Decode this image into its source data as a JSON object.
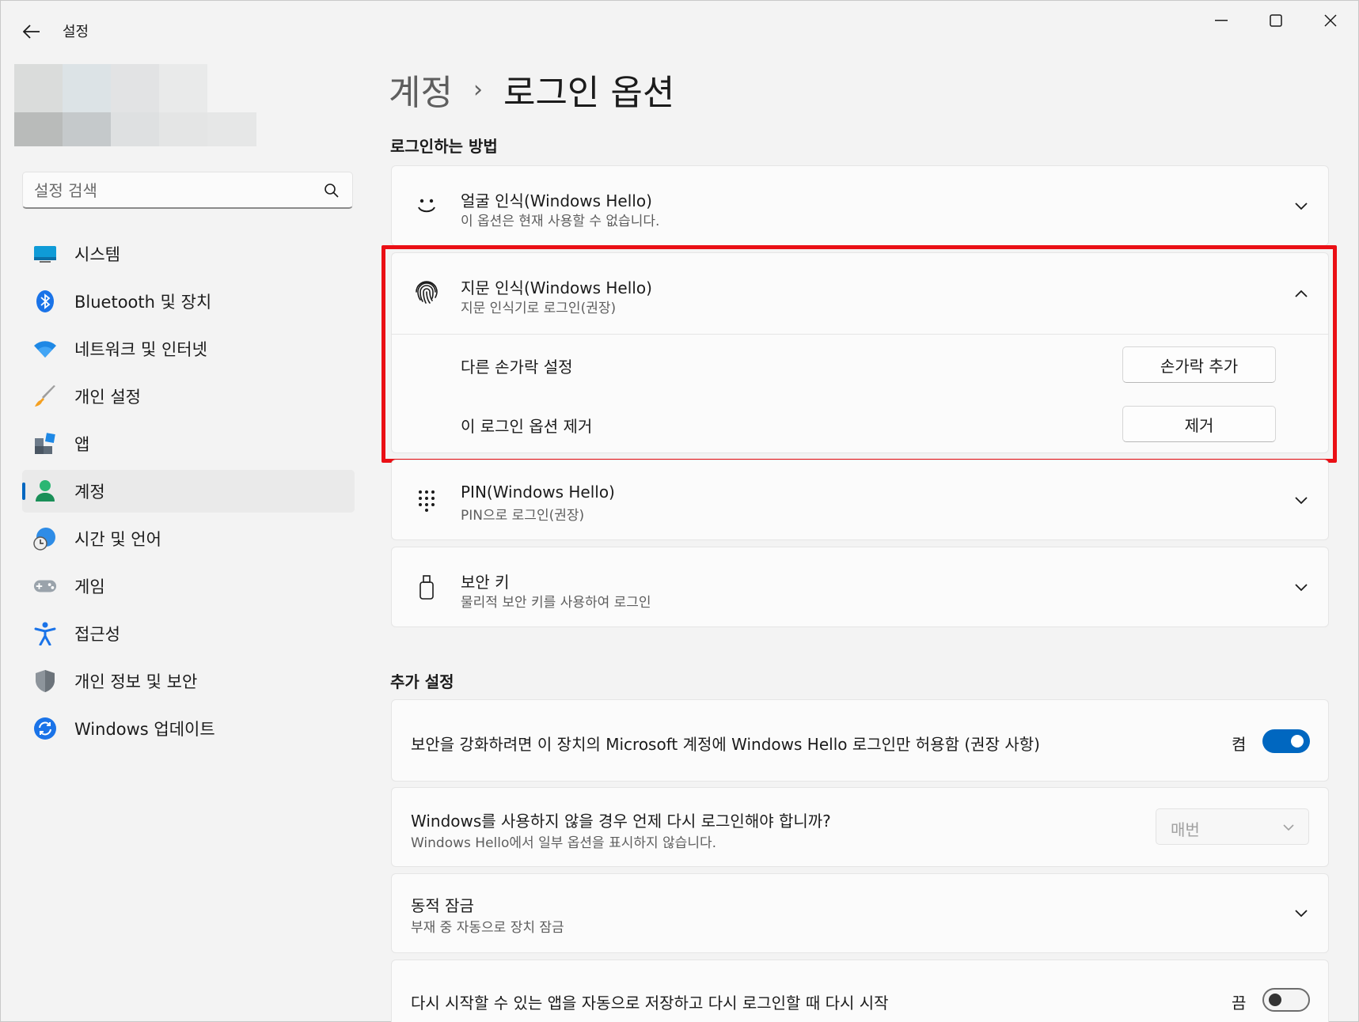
{
  "window": {
    "title": "설정"
  },
  "search": {
    "placeholder": "설정 검색"
  },
  "nav": {
    "items": [
      {
        "label": "시스템",
        "icon": "monitor-icon"
      },
      {
        "label": "Bluetooth 및 장치",
        "icon": "bluetooth-icon"
      },
      {
        "label": "네트워크 및 인터넷",
        "icon": "wifi-icon"
      },
      {
        "label": "개인 설정",
        "icon": "paintbrush-icon"
      },
      {
        "label": "앱",
        "icon": "apps-icon"
      },
      {
        "label": "계정",
        "icon": "person-icon",
        "active": true
      },
      {
        "label": "시간 및 언어",
        "icon": "globe-clock-icon"
      },
      {
        "label": "게임",
        "icon": "gamepad-icon"
      },
      {
        "label": "접근성",
        "icon": "accessibility-icon"
      },
      {
        "label": "개인 정보 및 보안",
        "icon": "shield-icon"
      },
      {
        "label": "Windows 업데이트",
        "icon": "update-icon"
      }
    ]
  },
  "breadcrumb": {
    "parent": "계정",
    "separator": "›",
    "current": "로그인 옵션"
  },
  "signin": {
    "section_title": "로그인하는 방법",
    "face": {
      "title": "얼굴 인식(Windows Hello)",
      "subtitle": "이 옵션은 현재 사용할 수 없습니다."
    },
    "fingerprint": {
      "title": "지문 인식(Windows Hello)",
      "subtitle": "지문 인식기로 로그인(권장)",
      "other_finger_label": "다른 손가락 설정",
      "add_finger_button": "손가락 추가",
      "remove_option_label": "이 로그인 옵션 제거",
      "remove_button": "제거"
    },
    "pin": {
      "title": "PIN(Windows Hello)",
      "subtitle": "PIN으로 로그인(권장)"
    },
    "security_key": {
      "title": "보안 키",
      "subtitle": "물리적 보안 키를 사용하여 로그인"
    }
  },
  "additional": {
    "section_title": "추가 설정",
    "hello_only": {
      "label": "보안을 강화하려면 이 장치의 Microsoft 계정에 Windows Hello 로그인만 허용함 (권장 사항)",
      "state_label": "켬",
      "on": true
    },
    "require_signin": {
      "title": "Windows를 사용하지 않을 경우 언제 다시 로그인해야 합니까?",
      "subtitle": "Windows Hello에서 일부 옵션을 표시하지 않습니다.",
      "value": "매번"
    },
    "dynamic_lock": {
      "title": "동적 잠금",
      "subtitle": "부재 중 자동으로 장치 잠금"
    },
    "restart_apps": {
      "label": "다시 시작할 수 있는 앱을 자동으로 저장하고 다시 로그인할 때 다시 시작",
      "state_label": "끔",
      "on": false
    }
  },
  "colors": {
    "accent": "#0067c0",
    "highlight": "#ea0f15"
  }
}
